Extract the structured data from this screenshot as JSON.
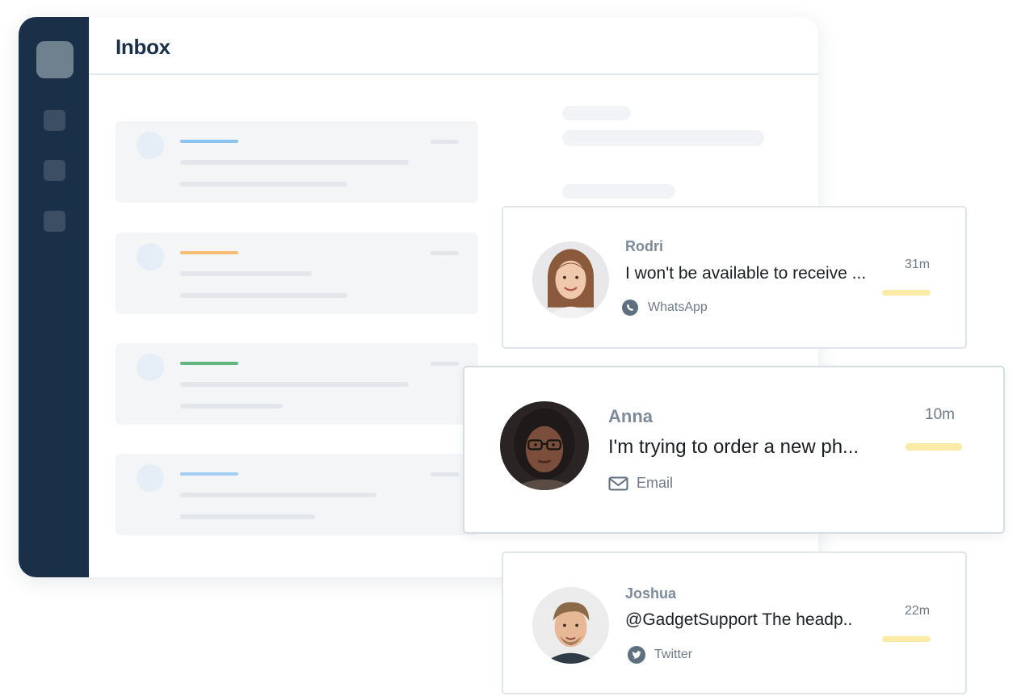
{
  "window": {
    "title": "Inbox"
  },
  "sidebar": {
    "item_count": 3
  },
  "skeleton_accents": [
    "#8cc3ef",
    "#f6bd72",
    "#63b67f",
    "#a3cdf2"
  ],
  "colors": {
    "sidebar": "#1a3049",
    "unread_bar": "#fbeba7"
  },
  "conversations": [
    {
      "name": "Rodri",
      "preview": "I won't be available to receive ...",
      "channel": "WhatsApp",
      "channel_icon": "whatsapp-icon",
      "time": "31m"
    },
    {
      "name": "Anna",
      "preview": "I'm trying to order a new ph...",
      "channel": "Email",
      "channel_icon": "envelope-icon",
      "time": "10m"
    },
    {
      "name": "Joshua",
      "preview": "@GadgetSupport The headp..",
      "channel": "Twitter",
      "channel_icon": "twitter-icon",
      "time": "22m"
    }
  ]
}
